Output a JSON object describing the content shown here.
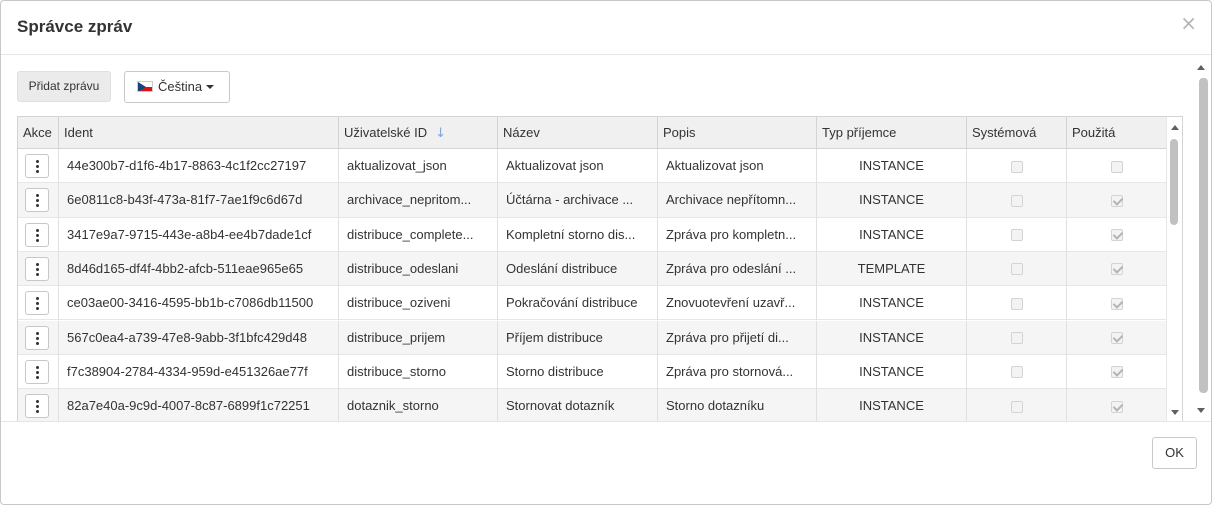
{
  "dialog": {
    "title": "Správce zpráv",
    "close_glyph": "×"
  },
  "toolbar": {
    "add_label": "Přidat zprávu",
    "language_label": "Čeština",
    "language_flag": "czech-flag"
  },
  "table": {
    "columns": {
      "akce": "Akce",
      "ident": "Ident",
      "uid": "Uživatelské ID",
      "uid_sort": "↓",
      "nazev": "Název",
      "popis": "Popis",
      "typ": "Typ příjemce",
      "systemova": "Systémová",
      "pouzita": "Použitá"
    },
    "rows": [
      {
        "ident": "44e300b7-d1f6-4b17-8863-4c1f2cc27197",
        "uid": "aktualizovat_json",
        "nazev": "Aktualizovat json",
        "popis": "Aktualizovat json",
        "typ": "INSTANCE",
        "systemova": false,
        "pouzita": false
      },
      {
        "ident": "6e0811c8-b43f-473a-81f7-7ae1f9c6d67d",
        "uid": "archivace_nepritom...",
        "nazev": "Účtárna - archivace ...",
        "popis": "Archivace nepřítomn...",
        "typ": "INSTANCE",
        "systemova": false,
        "pouzita": true
      },
      {
        "ident": "3417e9a7-9715-443e-a8b4-ee4b7dade1cf",
        "uid": "distribuce_complete...",
        "nazev": "Kompletní storno dis...",
        "popis": "Zpráva pro kompletn...",
        "typ": "INSTANCE",
        "systemova": false,
        "pouzita": true
      },
      {
        "ident": "8d46d165-df4f-4bb2-afcb-511eae965e65",
        "uid": "distribuce_odeslani",
        "nazev": "Odeslání distribuce",
        "popis": "Zpráva pro odeslání ...",
        "typ": "TEMPLATE",
        "systemova": false,
        "pouzita": true
      },
      {
        "ident": "ce03ae00-3416-4595-bb1b-c7086db11500",
        "uid": "distribuce_oziveni",
        "nazev": "Pokračování distribuce",
        "popis": "Znovuotevření uzavř...",
        "typ": "INSTANCE",
        "systemova": false,
        "pouzita": true
      },
      {
        "ident": "567c0ea4-a739-47e8-9abb-3f1bfc429d48",
        "uid": "distribuce_prijem",
        "nazev": "Příjem distribuce",
        "popis": "Zpráva pro přijetí di...",
        "typ": "INSTANCE",
        "systemova": false,
        "pouzita": true
      },
      {
        "ident": "f7c38904-2784-4334-959d-e451326ae77f",
        "uid": "distribuce_storno",
        "nazev": "Storno distribuce",
        "popis": "Zpráva pro stornová...",
        "typ": "INSTANCE",
        "systemova": false,
        "pouzita": true
      },
      {
        "ident": "82a7e40a-9c9d-4007-8c87-6899f1c72251",
        "uid": "dotaznik_storno",
        "nazev": "Stornovat dotazník",
        "popis": "Storno dotazníku",
        "typ": "INSTANCE",
        "systemova": false,
        "pouzita": true
      }
    ]
  },
  "footer": {
    "ok_label": "OK"
  }
}
